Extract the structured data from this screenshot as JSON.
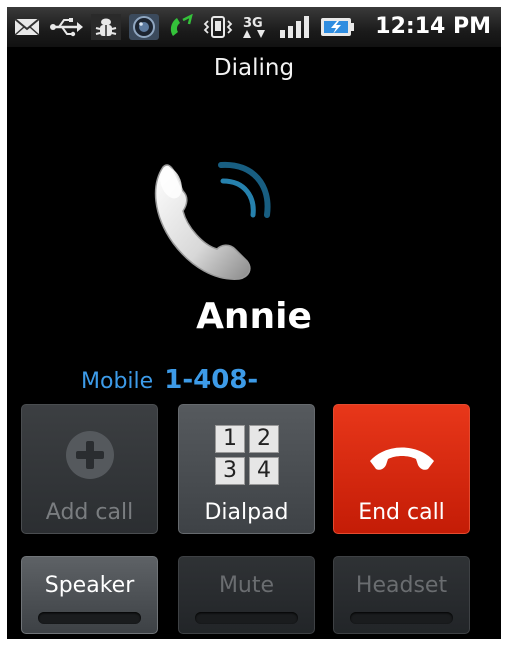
{
  "status_bar": {
    "time": "12:14 PM",
    "icons": [
      "mail-icon",
      "usb-icon",
      "debug-bug-icon",
      "camera-icon",
      "call-in-progress-icon",
      "vibrate-icon",
      "3g-data-icon",
      "signal-strength-icon",
      "battery-charging-icon"
    ],
    "network_label": "3G"
  },
  "call": {
    "status": "Dialing",
    "contact_name": "Annie",
    "number_type": "Mobile",
    "number": "1-408-"
  },
  "buttons": {
    "add_call": "Add call",
    "dialpad": "Dialpad",
    "dialpad_keys": [
      "1",
      "2",
      "3",
      "4"
    ],
    "end_call": "End call",
    "speaker": "Speaker",
    "mute": "Mute",
    "headset": "Headset"
  },
  "colors": {
    "accent_blue": "#3d9be8",
    "end_call_red": "#d42a0f",
    "background": "#000000"
  }
}
